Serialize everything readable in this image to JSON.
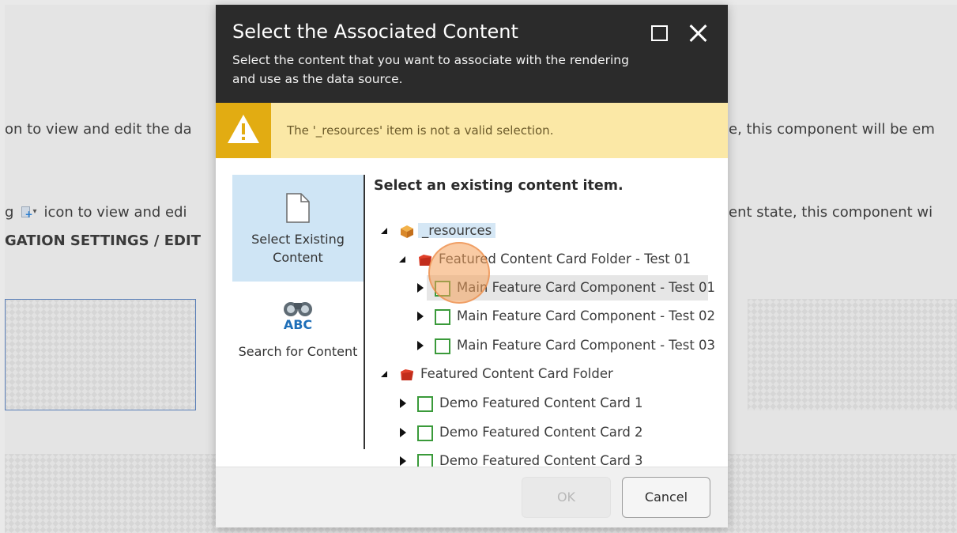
{
  "background": {
    "line1": "on to view and edit the da",
    "line1_right": "e, this component will be em",
    "line2_prefix": "g",
    "line2_text": "icon to view and edi",
    "line2_right": "ent state, this component wi",
    "line3": "GATION SETTINGS / EDIT"
  },
  "dialog": {
    "title": "Select the Associated Content",
    "subtitle": "Select the content that you want to associate with the rendering and use as the data source.",
    "maximize_icon": "maximize-icon",
    "close_icon": "close-icon"
  },
  "warning": {
    "icon": "warning-triangle-icon",
    "message": "The '_resources' item is not a valid selection."
  },
  "nav": {
    "items": [
      {
        "label": "Select Existing Content",
        "icon": "document-icon",
        "active": true
      },
      {
        "label": "Search for Content",
        "icon": "binoculars-abc-icon",
        "active": false
      }
    ]
  },
  "tree": {
    "heading": "Select an existing content item.",
    "nodes": [
      {
        "label": "_resources",
        "icon": "package-icon",
        "expanded": true,
        "level": 0
      },
      {
        "label": "Featured Content Card Folder - Test 01",
        "icon": "folder-red-icon",
        "expanded": true,
        "level": 1
      },
      {
        "label": "Main Feature Card Component - Test 01",
        "icon": "item-green-icon",
        "expanded": false,
        "level": 2,
        "selected": true
      },
      {
        "label": "Main Feature Card Component - Test 02",
        "icon": "item-green-icon",
        "expanded": false,
        "level": 2
      },
      {
        "label": "Main Feature Card Component - Test 03",
        "icon": "item-green-icon",
        "expanded": false,
        "level": 2
      },
      {
        "label": "Featured Content Card Folder",
        "icon": "folder-red-icon",
        "expanded": true,
        "level": 0
      },
      {
        "label": "Demo Featured Content Card 1",
        "icon": "item-green-icon",
        "expanded": false,
        "level": 1
      },
      {
        "label": "Demo Featured Content Card 2",
        "icon": "item-green-icon",
        "expanded": false,
        "level": 1
      },
      {
        "label": "Demo Featured Content Card 3",
        "icon": "item-green-icon",
        "expanded": false,
        "level": 1
      }
    ]
  },
  "footer": {
    "ok_label": "OK",
    "cancel_label": "Cancel"
  },
  "colors": {
    "header_bg": "#2b2b2b",
    "warning_bg": "#fbe8a6",
    "warning_icon_bg": "#e2ac12",
    "nav_active_bg": "#cfe5f5",
    "item_icon_border": "#3a9a3a",
    "folder_icon": "#e0402a"
  }
}
